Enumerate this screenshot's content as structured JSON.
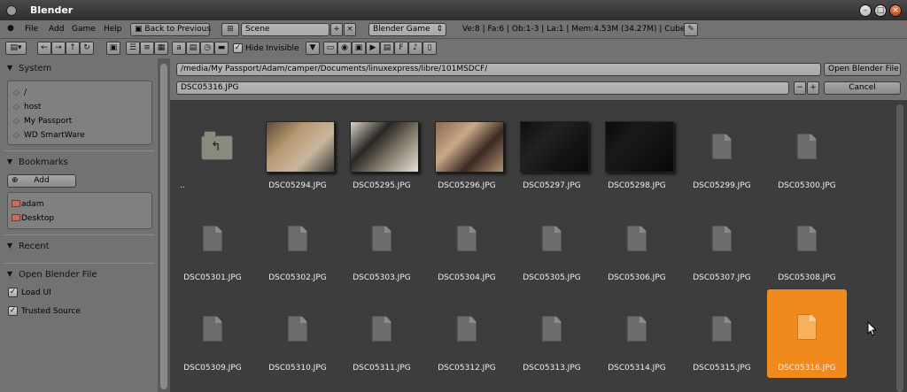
{
  "window": {
    "title": "Blender"
  },
  "menu": [
    "File",
    "Add",
    "Game",
    "Help"
  ],
  "header": {
    "back_button": "Back to Previous",
    "scene_name": "Scene",
    "engine": "Blender Game",
    "stats": "Ve:8 | Fa:6 | Ob:1-3 | La:1 | Mem:4.53M (34.27M) | Cube"
  },
  "fb_header": {
    "hide_invisible_label": "Hide Invisible",
    "hide_invisible_checked": true
  },
  "sidebar": {
    "system": {
      "title": "System",
      "items": [
        "/",
        "host",
        "My Passport",
        "WD SmartWare"
      ]
    },
    "bookmarks": {
      "title": "Bookmarks",
      "add_label": "Add",
      "items": [
        "adam",
        "Desktop"
      ]
    },
    "recent": {
      "title": "Recent"
    },
    "open_blender_file": {
      "title": "Open Blender File",
      "options": [
        {
          "label": "Load UI",
          "checked": true
        },
        {
          "label": "Trusted Source",
          "checked": true
        }
      ]
    }
  },
  "path": {
    "directory": "/media/My Passport/Adam/camper/Documents/linuxexpress/libre/101MSDCF/",
    "filename": "DSC05316.JPG",
    "open_button": "Open Blender File",
    "cancel_button": "Cancel"
  },
  "files": [
    {
      "name": "..",
      "kind": "parent"
    },
    {
      "name": "DSC05294.JPG",
      "kind": "thumb",
      "colors": [
        "#5a4a3a",
        "#b99a72",
        "#c8b6a0",
        "#3a3a32"
      ]
    },
    {
      "name": "DSC05295.JPG",
      "kind": "thumb",
      "colors": [
        "#d8d2c8",
        "#2a2624",
        "#8a8070",
        "#e6e0d6"
      ]
    },
    {
      "name": "DSC05296.JPG",
      "kind": "thumb",
      "colors": [
        "#8a6a50",
        "#c8a888",
        "#3a2a22",
        "#b29070"
      ]
    },
    {
      "name": "DSC05297.JPG",
      "kind": "thumb",
      "colors": [
        "#0e0e0e",
        "#242220",
        "#161412",
        "#0a0a0a"
      ]
    },
    {
      "name": "DSC05298.JPG",
      "kind": "thumb",
      "colors": [
        "#0a0a0a",
        "#1c1a18",
        "#121110",
        "#080808"
      ]
    },
    {
      "name": "DSC05299.JPG",
      "kind": "doc"
    },
    {
      "name": "DSC05300.JPG",
      "kind": "doc"
    },
    {
      "name": "DSC05301.JPG",
      "kind": "doc"
    },
    {
      "name": "DSC05302.JPG",
      "kind": "doc"
    },
    {
      "name": "DSC05303.JPG",
      "kind": "doc"
    },
    {
      "name": "DSC05304.JPG",
      "kind": "doc"
    },
    {
      "name": "DSC05305.JPG",
      "kind": "doc"
    },
    {
      "name": "DSC05306.JPG",
      "kind": "doc"
    },
    {
      "name": "DSC05307.JPG",
      "kind": "doc"
    },
    {
      "name": "DSC05308.JPG",
      "kind": "doc"
    },
    {
      "name": "DSC05309.JPG",
      "kind": "doc"
    },
    {
      "name": "DSC05310.JPG",
      "kind": "doc"
    },
    {
      "name": "DSC05311.JPG",
      "kind": "doc"
    },
    {
      "name": "DSC05312.JPG",
      "kind": "doc"
    },
    {
      "name": "DSC05313.JPG",
      "kind": "doc"
    },
    {
      "name": "DSC05314.JPG",
      "kind": "doc"
    },
    {
      "name": "DSC05315.JPG",
      "kind": "doc"
    },
    {
      "name": "DSC05316.JPG",
      "kind": "doc",
      "selected": true
    }
  ],
  "colors": {
    "selection": "#f08a1c",
    "panel": "#727272",
    "background": "#3d3d3d"
  },
  "icons": {
    "window_buttons": [
      "minimize-icon",
      "maximize-icon",
      "close-icon"
    ],
    "toolbar": [
      "parent-dir-icon",
      "refresh-icon",
      "bookmark-icon",
      "new-folder-icon",
      "display-mode-icon",
      "sort-icon",
      "filter-icon",
      "folder-filter-icon",
      "blend-filter-icon",
      "image-filter-icon",
      "movie-filter-icon",
      "script-filter-icon",
      "font-filter-icon",
      "sound-filter-icon",
      "text-filter-icon"
    ]
  }
}
